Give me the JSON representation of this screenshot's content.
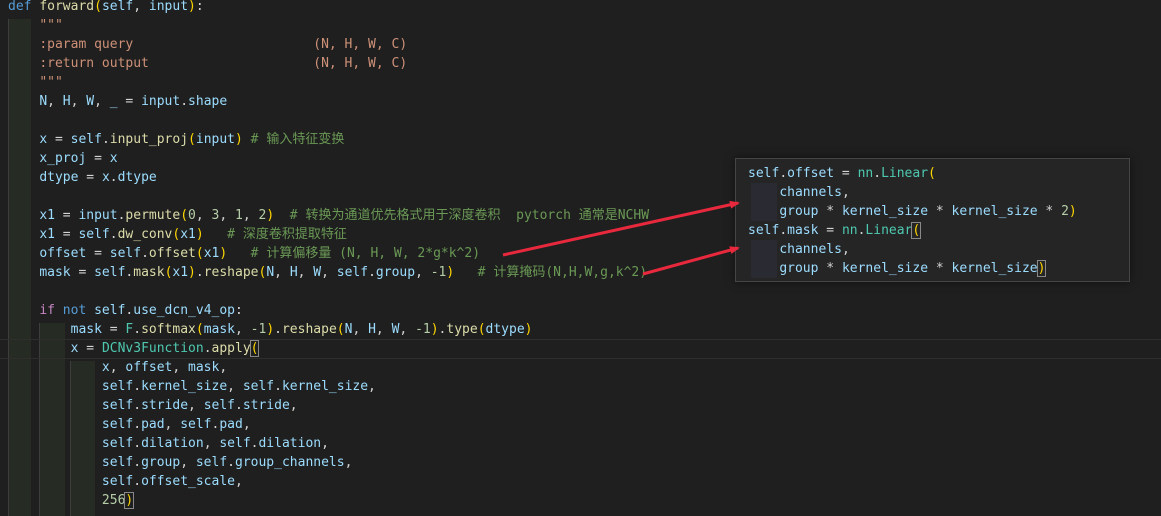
{
  "editor": {
    "lines": [
      [
        {
          "t": "def",
          "c": "tk-kw"
        },
        {
          "t": " "
        },
        {
          "t": "forward",
          "c": "tk-fn"
        },
        {
          "t": "(",
          "c": "tk-b1"
        },
        {
          "t": "self",
          "c": "tk-var"
        },
        {
          "t": ", "
        },
        {
          "t": "input",
          "c": "tk-var"
        },
        {
          "t": ")",
          "c": "tk-b1"
        },
        {
          "t": ":"
        }
      ],
      [
        {
          "t": "    "
        },
        {
          "t": "\"\"\"",
          "c": "tk-str"
        }
      ],
      [
        {
          "t": "    "
        },
        {
          "t": ":param query                       (N, H, W, C)",
          "c": "tk-str"
        }
      ],
      [
        {
          "t": "    "
        },
        {
          "t": ":return output                     (N, H, W, C)",
          "c": "tk-str"
        }
      ],
      [
        {
          "t": "    "
        },
        {
          "t": "\"\"\"",
          "c": "tk-str"
        }
      ],
      [
        {
          "t": "    "
        },
        {
          "t": "N",
          "c": "tk-var"
        },
        {
          "t": ", "
        },
        {
          "t": "H",
          "c": "tk-var"
        },
        {
          "t": ", "
        },
        {
          "t": "W",
          "c": "tk-var"
        },
        {
          "t": ", "
        },
        {
          "t": "_",
          "c": "tk-var"
        },
        {
          "t": " = "
        },
        {
          "t": "input",
          "c": "tk-var"
        },
        {
          "t": "."
        },
        {
          "t": "shape",
          "c": "tk-var"
        }
      ],
      [],
      [
        {
          "t": "    "
        },
        {
          "t": "x",
          "c": "tk-var"
        },
        {
          "t": " = "
        },
        {
          "t": "self",
          "c": "tk-var"
        },
        {
          "t": "."
        },
        {
          "t": "input_proj",
          "c": "tk-fn"
        },
        {
          "t": "(",
          "c": "tk-b1"
        },
        {
          "t": "input",
          "c": "tk-var"
        },
        {
          "t": ")",
          "c": "tk-b1"
        },
        {
          "t": " # 输入特征变换",
          "c": "tk-com"
        }
      ],
      [
        {
          "t": "    "
        },
        {
          "t": "x_proj",
          "c": "tk-var"
        },
        {
          "t": " = "
        },
        {
          "t": "x",
          "c": "tk-var"
        }
      ],
      [
        {
          "t": "    "
        },
        {
          "t": "dtype",
          "c": "tk-var"
        },
        {
          "t": " = "
        },
        {
          "t": "x",
          "c": "tk-var"
        },
        {
          "t": "."
        },
        {
          "t": "dtype",
          "c": "tk-var"
        }
      ],
      [],
      [
        {
          "t": "    "
        },
        {
          "t": "x1",
          "c": "tk-var"
        },
        {
          "t": " = "
        },
        {
          "t": "input",
          "c": "tk-var"
        },
        {
          "t": "."
        },
        {
          "t": "permute",
          "c": "tk-fn"
        },
        {
          "t": "(",
          "c": "tk-b1"
        },
        {
          "t": "0",
          "c": "tk-num"
        },
        {
          "t": ", "
        },
        {
          "t": "3",
          "c": "tk-num"
        },
        {
          "t": ", "
        },
        {
          "t": "1",
          "c": "tk-num"
        },
        {
          "t": ", "
        },
        {
          "t": "2",
          "c": "tk-num"
        },
        {
          "t": ")",
          "c": "tk-b1"
        },
        {
          "t": "  # 转换为通道优先格式用于深度卷积  pytorch 通常是NCHW",
          "c": "tk-com"
        }
      ],
      [
        {
          "t": "    "
        },
        {
          "t": "x1",
          "c": "tk-var"
        },
        {
          "t": " = "
        },
        {
          "t": "self",
          "c": "tk-var"
        },
        {
          "t": "."
        },
        {
          "t": "dw_conv",
          "c": "tk-fn"
        },
        {
          "t": "(",
          "c": "tk-b1"
        },
        {
          "t": "x1",
          "c": "tk-var"
        },
        {
          "t": ")",
          "c": "tk-b1"
        },
        {
          "t": "   # 深度卷积提取特征",
          "c": "tk-com"
        }
      ],
      [
        {
          "t": "    "
        },
        {
          "t": "offset",
          "c": "tk-var"
        },
        {
          "t": " = "
        },
        {
          "t": "self",
          "c": "tk-var"
        },
        {
          "t": "."
        },
        {
          "t": "offset",
          "c": "tk-fn"
        },
        {
          "t": "(",
          "c": "tk-b1"
        },
        {
          "t": "x1",
          "c": "tk-var"
        },
        {
          "t": ")",
          "c": "tk-b1"
        },
        {
          "t": "   # 计算偏移量 (N, H, W, 2*g*k^2)",
          "c": "tk-com"
        }
      ],
      [
        {
          "t": "    "
        },
        {
          "t": "mask",
          "c": "tk-var"
        },
        {
          "t": " = "
        },
        {
          "t": "self",
          "c": "tk-var"
        },
        {
          "t": "."
        },
        {
          "t": "mask",
          "c": "tk-fn"
        },
        {
          "t": "(",
          "c": "tk-b1"
        },
        {
          "t": "x1",
          "c": "tk-var"
        },
        {
          "t": ")",
          "c": "tk-b1"
        },
        {
          "t": "."
        },
        {
          "t": "reshape",
          "c": "tk-fn"
        },
        {
          "t": "(",
          "c": "tk-b1"
        },
        {
          "t": "N",
          "c": "tk-var"
        },
        {
          "t": ", "
        },
        {
          "t": "H",
          "c": "tk-var"
        },
        {
          "t": ", "
        },
        {
          "t": "W",
          "c": "tk-var"
        },
        {
          "t": ", "
        },
        {
          "t": "self",
          "c": "tk-var"
        },
        {
          "t": "."
        },
        {
          "t": "group",
          "c": "tk-var"
        },
        {
          "t": ", "
        },
        {
          "t": "-1",
          "c": "tk-num"
        },
        {
          "t": ")",
          "c": "tk-b1"
        },
        {
          "t": "   # 计算掩码(N,H,W,g,k^2)",
          "c": "tk-com"
        }
      ],
      [],
      [
        {
          "t": "    "
        },
        {
          "t": "if",
          "c": "tk-ctrl"
        },
        {
          "t": " "
        },
        {
          "t": "not",
          "c": "tk-kw"
        },
        {
          "t": " "
        },
        {
          "t": "self",
          "c": "tk-var"
        },
        {
          "t": "."
        },
        {
          "t": "use_dcn_v4_op",
          "c": "tk-var"
        },
        {
          "t": ":"
        }
      ],
      [
        {
          "t": "        "
        },
        {
          "t": "mask",
          "c": "tk-var"
        },
        {
          "t": " = "
        },
        {
          "t": "F",
          "c": "tk-cls"
        },
        {
          "t": "."
        },
        {
          "t": "softmax",
          "c": "tk-fn"
        },
        {
          "t": "(",
          "c": "tk-b1"
        },
        {
          "t": "mask",
          "c": "tk-var"
        },
        {
          "t": ", "
        },
        {
          "t": "-1",
          "c": "tk-num"
        },
        {
          "t": ")",
          "c": "tk-b1"
        },
        {
          "t": "."
        },
        {
          "t": "reshape",
          "c": "tk-fn"
        },
        {
          "t": "(",
          "c": "tk-b1"
        },
        {
          "t": "N",
          "c": "tk-var"
        },
        {
          "t": ", "
        },
        {
          "t": "H",
          "c": "tk-var"
        },
        {
          "t": ", "
        },
        {
          "t": "W",
          "c": "tk-var"
        },
        {
          "t": ", "
        },
        {
          "t": "-1",
          "c": "tk-num"
        },
        {
          "t": ")",
          "c": "tk-b1"
        },
        {
          "t": "."
        },
        {
          "t": "type",
          "c": "tk-fn"
        },
        {
          "t": "(",
          "c": "tk-b1"
        },
        {
          "t": "dtype",
          "c": "tk-var"
        },
        {
          "t": ")",
          "c": "tk-b1"
        }
      ],
      [
        {
          "t": "        "
        },
        {
          "t": "x",
          "c": "tk-var"
        },
        {
          "t": " = "
        },
        {
          "t": "DCNv3Function",
          "c": "tk-cls"
        },
        {
          "t": "."
        },
        {
          "t": "apply",
          "c": "tk-fn"
        },
        {
          "t": "(",
          "c": "tk-b1 bracket-match"
        }
      ],
      [
        {
          "t": "            "
        },
        {
          "t": "x",
          "c": "tk-var"
        },
        {
          "t": ", "
        },
        {
          "t": "offset",
          "c": "tk-var"
        },
        {
          "t": ", "
        },
        {
          "t": "mask",
          "c": "tk-var"
        },
        {
          "t": ","
        }
      ],
      [
        {
          "t": "            "
        },
        {
          "t": "self",
          "c": "tk-var"
        },
        {
          "t": "."
        },
        {
          "t": "kernel_size",
          "c": "tk-var"
        },
        {
          "t": ", "
        },
        {
          "t": "self",
          "c": "tk-var"
        },
        {
          "t": "."
        },
        {
          "t": "kernel_size",
          "c": "tk-var"
        },
        {
          "t": ","
        }
      ],
      [
        {
          "t": "            "
        },
        {
          "t": "self",
          "c": "tk-var"
        },
        {
          "t": "."
        },
        {
          "t": "stride",
          "c": "tk-var"
        },
        {
          "t": ", "
        },
        {
          "t": "self",
          "c": "tk-var"
        },
        {
          "t": "."
        },
        {
          "t": "stride",
          "c": "tk-var"
        },
        {
          "t": ","
        }
      ],
      [
        {
          "t": "            "
        },
        {
          "t": "self",
          "c": "tk-var"
        },
        {
          "t": "."
        },
        {
          "t": "pad",
          "c": "tk-var"
        },
        {
          "t": ", "
        },
        {
          "t": "self",
          "c": "tk-var"
        },
        {
          "t": "."
        },
        {
          "t": "pad",
          "c": "tk-var"
        },
        {
          "t": ","
        }
      ],
      [
        {
          "t": "            "
        },
        {
          "t": "self",
          "c": "tk-var"
        },
        {
          "t": "."
        },
        {
          "t": "dilation",
          "c": "tk-var"
        },
        {
          "t": ", "
        },
        {
          "t": "self",
          "c": "tk-var"
        },
        {
          "t": "."
        },
        {
          "t": "dilation",
          "c": "tk-var"
        },
        {
          "t": ","
        }
      ],
      [
        {
          "t": "            "
        },
        {
          "t": "self",
          "c": "tk-var"
        },
        {
          "t": "."
        },
        {
          "t": "group",
          "c": "tk-var"
        },
        {
          "t": ", "
        },
        {
          "t": "self",
          "c": "tk-var"
        },
        {
          "t": "."
        },
        {
          "t": "group_channels",
          "c": "tk-var"
        },
        {
          "t": ","
        }
      ],
      [
        {
          "t": "            "
        },
        {
          "t": "self",
          "c": "tk-var"
        },
        {
          "t": "."
        },
        {
          "t": "offset_scale",
          "c": "tk-var"
        },
        {
          "t": ","
        }
      ],
      [
        {
          "t": "            "
        },
        {
          "t": "256",
          "c": "tk-num"
        },
        {
          "t": ")",
          "c": "tk-b1 bracket-match"
        }
      ]
    ]
  },
  "hover_popup": {
    "lines": [
      [
        {
          "t": "self",
          "c": "tk-var"
        },
        {
          "t": "."
        },
        {
          "t": "offset",
          "c": "tk-var"
        },
        {
          "t": " = "
        },
        {
          "t": "nn",
          "c": "tk-cls"
        },
        {
          "t": "."
        },
        {
          "t": "Linear",
          "c": "tk-cls"
        },
        {
          "t": "(",
          "c": "tk-b1"
        }
      ],
      [
        {
          "t": "    "
        },
        {
          "t": "channels",
          "c": "tk-var"
        },
        {
          "t": ","
        }
      ],
      [
        {
          "t": "    "
        },
        {
          "t": "group",
          "c": "tk-var"
        },
        {
          "t": " * "
        },
        {
          "t": "kernel_size",
          "c": "tk-var"
        },
        {
          "t": " * "
        },
        {
          "t": "kernel_size",
          "c": "tk-var"
        },
        {
          "t": " * "
        },
        {
          "t": "2",
          "c": "tk-num"
        },
        {
          "t": ")",
          "c": "tk-b1"
        }
      ],
      [
        {
          "t": "self",
          "c": "tk-var"
        },
        {
          "t": "."
        },
        {
          "t": "mask",
          "c": "tk-var"
        },
        {
          "t": " = "
        },
        {
          "t": "nn",
          "c": "tk-cls"
        },
        {
          "t": "."
        },
        {
          "t": "Linear",
          "c": "tk-cls"
        },
        {
          "t": "(",
          "c": "tk-b1 bracket-match"
        }
      ],
      [
        {
          "t": "    "
        },
        {
          "t": "channels",
          "c": "tk-var"
        },
        {
          "t": ","
        }
      ],
      [
        {
          "t": "    "
        },
        {
          "t": "group",
          "c": "tk-var"
        },
        {
          "t": " * "
        },
        {
          "t": "kernel_size",
          "c": "tk-var"
        },
        {
          "t": " * "
        },
        {
          "t": "kernel_size",
          "c": "tk-var"
        },
        {
          "t": ")",
          "c": "tk-b1 bracket-match"
        }
      ]
    ]
  },
  "colors": {
    "background": "#1f1f1f",
    "popup_background": "#252526",
    "annotation_arrow": "#e8283c"
  }
}
